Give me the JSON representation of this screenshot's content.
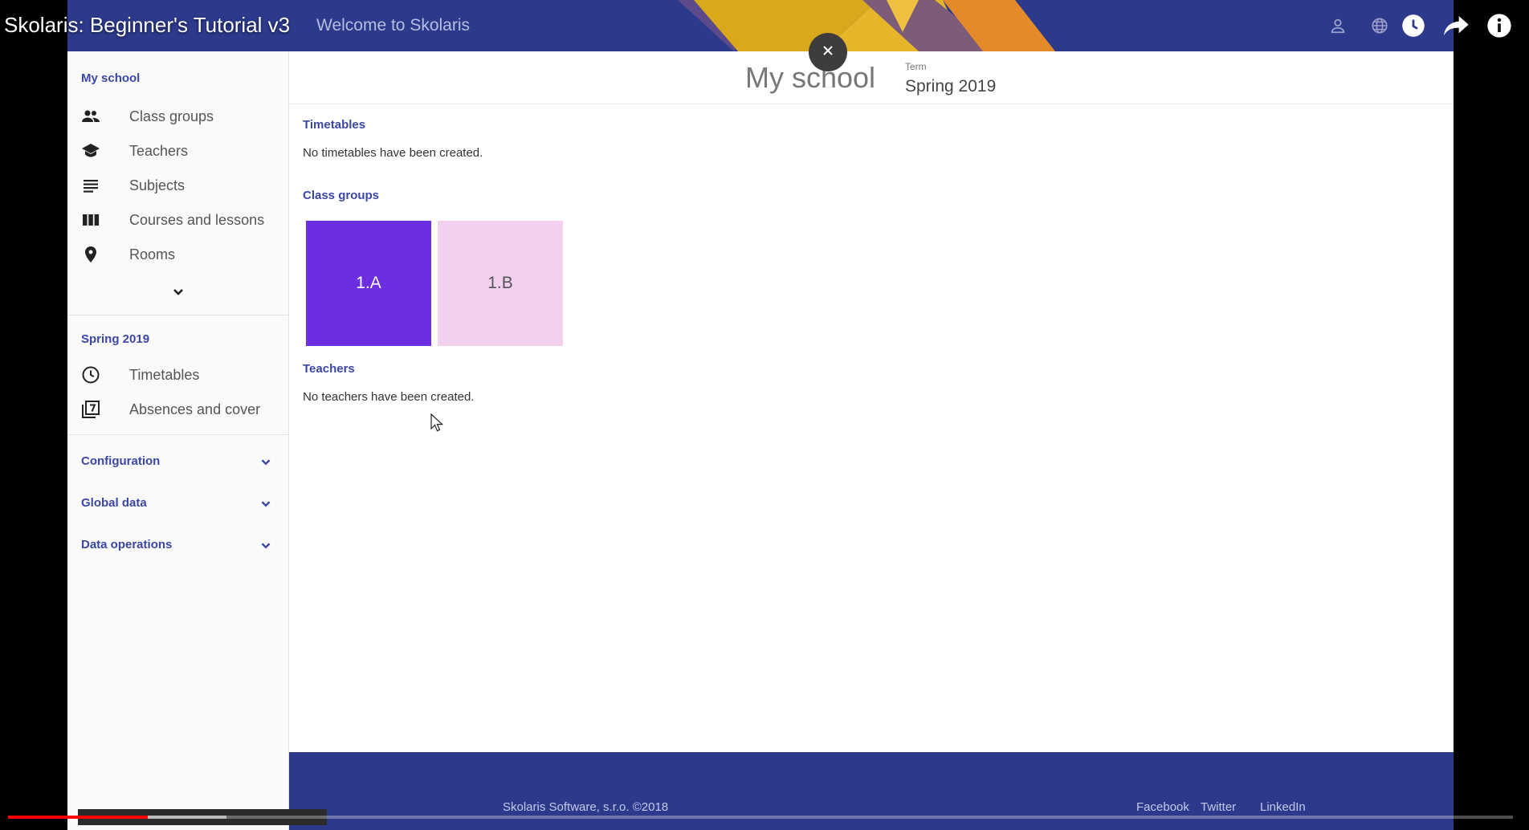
{
  "video": {
    "title": "Skolaris: Beginner's Tutorial v3",
    "progress_fraction": 0.093,
    "buffered_fraction": 0.145
  },
  "header": {
    "welcome": "Welcome to Skolaris"
  },
  "sidebar": {
    "my_school_label": "My school",
    "school_items": [
      {
        "label": "Class groups",
        "icon": "people-icon"
      },
      {
        "label": "Teachers",
        "icon": "graduation-cap-icon"
      },
      {
        "label": "Subjects",
        "icon": "subject-lines-icon"
      },
      {
        "label": "Courses and lessons",
        "icon": "columns-icon"
      },
      {
        "label": "Rooms",
        "icon": "location-pin-icon"
      }
    ],
    "term_label": "Spring 2019",
    "term_items": [
      {
        "label": "Timetables",
        "icon": "clock-icon"
      },
      {
        "label": "Absences and cover",
        "icon": "calendar-seven-icon"
      }
    ],
    "sections": [
      "Configuration",
      "Global data",
      "Data operations"
    ]
  },
  "main": {
    "title": "My school",
    "term_caption": "Term",
    "term_value": "Spring 2019",
    "timetables_heading": "Timetables",
    "timetables_empty": "No timetables have been created.",
    "class_groups_heading": "Class groups",
    "class_groups": [
      {
        "label": "1.A",
        "color": "#6c2ee0",
        "text_color": "#ffffff"
      },
      {
        "label": "1.B",
        "color": "#f4d0ef",
        "text_color": "#555555"
      }
    ],
    "teachers_heading": "Teachers",
    "teachers_empty": "No teachers have been created."
  },
  "footer": {
    "copyright": "Skolaris Software, s.r.o. ©2018",
    "links": [
      "Facebook",
      "Twitter",
      "LinkedIn"
    ]
  },
  "colors": {
    "brand": "#2d3a8c",
    "accent": "#3a47a6",
    "progress": "#ff0000"
  }
}
